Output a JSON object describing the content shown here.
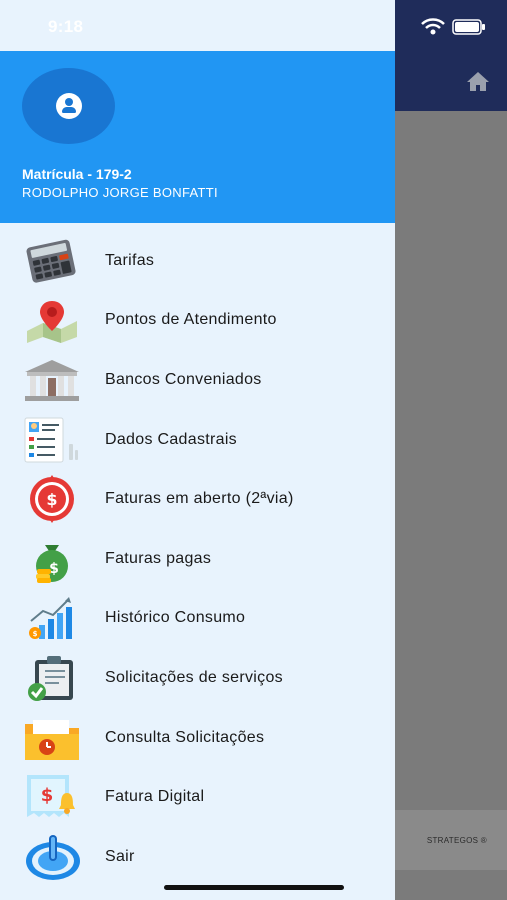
{
  "status_bar": {
    "time": "9:18"
  },
  "profile": {
    "matricula": "Matrícula - 179-2",
    "name": "RODOLPHO JORGE BONFATTI"
  },
  "menu": [
    {
      "label": "Tarifas",
      "icon": "calculator-icon"
    },
    {
      "label": "Pontos de Atendimento",
      "icon": "map-pin-icon"
    },
    {
      "label": "Bancos Conveniados",
      "icon": "bank-icon"
    },
    {
      "label": "Dados Cadastrais",
      "icon": "id-card-icon"
    },
    {
      "label": "Faturas em aberto (2ªvia)",
      "icon": "dollar-coin-icon"
    },
    {
      "label": "Faturas pagas",
      "icon": "money-bag-icon"
    },
    {
      "label": "Histórico Consumo",
      "icon": "growth-chart-icon"
    },
    {
      "label": "Solicitações de serviços",
      "icon": "clipboard-check-icon"
    },
    {
      "label": "Consulta Solicitações",
      "icon": "folder-clock-icon"
    },
    {
      "label": "Fatura Digital",
      "icon": "digital-invoice-icon"
    },
    {
      "label": "Sair",
      "icon": "power-icon"
    }
  ],
  "background": {
    "footer_text": "STRATEGOS ®"
  },
  "colors": {
    "drawer_bg": "#e8f3fd",
    "profile_bg": "#2196f3",
    "avatar_bg": "#1976d2",
    "app_header": "#1f2c5a"
  }
}
